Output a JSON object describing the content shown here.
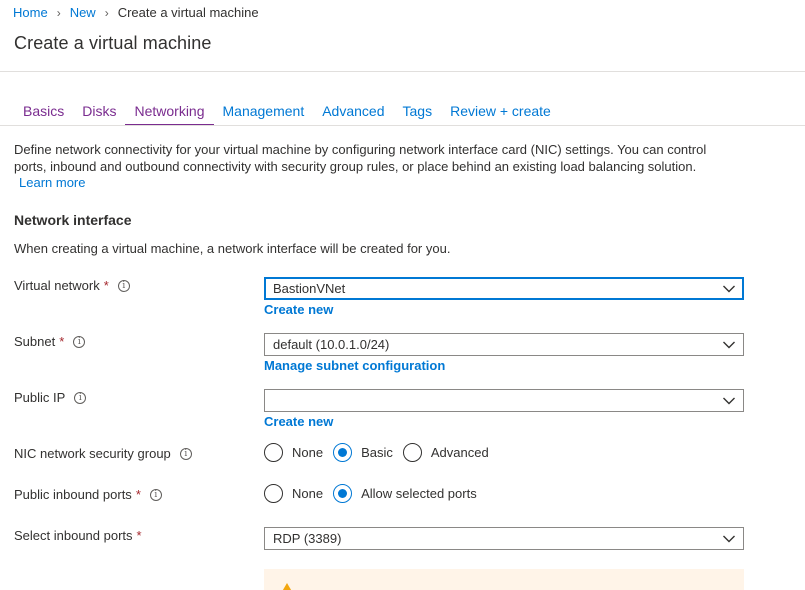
{
  "breadcrumb": {
    "home": "Home",
    "new": "New",
    "current": "Create a virtual machine"
  },
  "page": {
    "title": "Create a virtual machine"
  },
  "tabs": [
    {
      "label": "Basics"
    },
    {
      "label": "Disks"
    },
    {
      "label": "Networking"
    },
    {
      "label": "Management"
    },
    {
      "label": "Advanced"
    },
    {
      "label": "Tags"
    },
    {
      "label": "Review + create"
    }
  ],
  "active_tab": "Networking",
  "intro": {
    "description": "Define network connectivity for your virtual machine by configuring network interface card (NIC) settings. You can control ports, inbound and outbound connectivity with security group rules, or place behind an existing load balancing solution.",
    "learn_more": "Learn more"
  },
  "network_interface": {
    "title": "Network interface",
    "description": "When creating a virtual machine, a network interface will be created for you."
  },
  "fields": {
    "virtual_network": {
      "label": "Virtual network",
      "required": "*",
      "value": "BastionVNet",
      "link": "Create new"
    },
    "subnet": {
      "label": "Subnet",
      "required": "*",
      "value": "default (10.0.1.0/24)",
      "link": "Manage subnet configuration"
    },
    "public_ip": {
      "label": "Public IP",
      "value": "",
      "link": "Create new"
    },
    "nic_nsg": {
      "label": "NIC network security group",
      "options": [
        "None",
        "Basic",
        "Advanced"
      ],
      "selected": "Basic"
    },
    "public_inbound_ports": {
      "label": "Public inbound ports",
      "required": "*",
      "options": [
        "None",
        "Allow selected ports"
      ],
      "selected": "Allow selected ports"
    },
    "select_inbound_ports": {
      "label": "Select inbound ports",
      "required": "*",
      "value": "RDP (3389)"
    }
  },
  "icons": {
    "info": "info-icon",
    "chevron": "chevron-down-icon",
    "warning": "warning-icon",
    "separator": "chevron-right-icon"
  },
  "colors": {
    "accent": "#0078d4",
    "tab_active": "#7a2c8f",
    "required": "#a4262c",
    "warning_bg": "#fff4e8",
    "warning_icon": "#f2a60f"
  }
}
